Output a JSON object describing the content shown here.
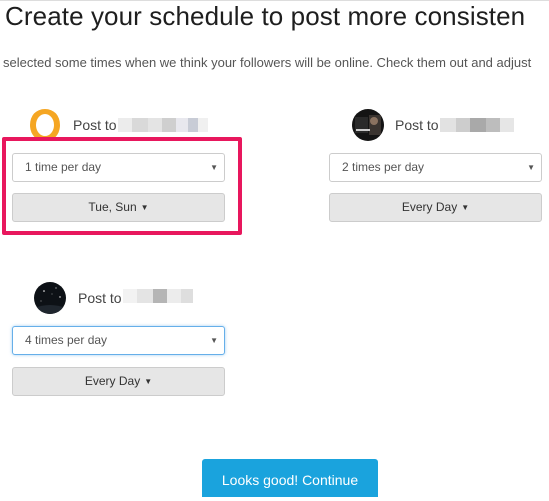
{
  "header": {
    "title": "Create your schedule to post more consisten",
    "subtitle": "selected some times when we think your followers will be online. Check them out and adjust"
  },
  "profiles": [
    {
      "post_to_label": "Post to",
      "avatar_icon": "orange-ring-avatar",
      "frequency_value": "1 time per day",
      "days_value": "Tue, Sun",
      "highlighted": true
    },
    {
      "post_to_label": "Post to",
      "avatar_icon": "dark-photo-avatar",
      "frequency_value": "2 times per day",
      "days_value": "Every Day",
      "highlighted": false
    },
    {
      "post_to_label": "Post to",
      "avatar_icon": "night-sky-avatar",
      "frequency_value": "4 times per day",
      "days_value": "Every Day",
      "highlighted": false
    }
  ],
  "continue_button": {
    "label": "Looks good! Continue"
  },
  "colors": {
    "accent": "#1aa3dd",
    "highlight_border": "#e8175d",
    "avatar_orange": "#f5a623"
  }
}
